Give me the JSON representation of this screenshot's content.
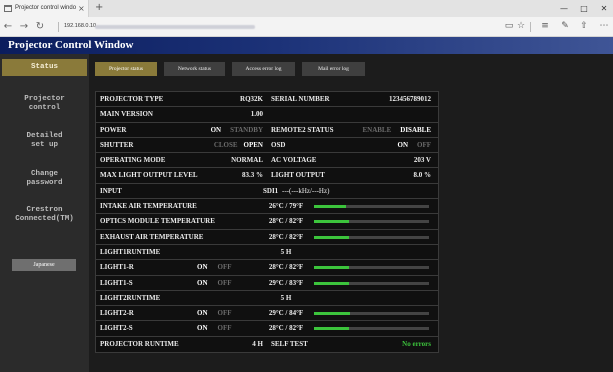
{
  "browser": {
    "tab_title": "Projector control windo",
    "tab_close": {
      "name": "close-icon",
      "glyph": "×"
    },
    "new_tab": {
      "name": "plus-icon",
      "glyph": "+"
    },
    "window_controls": {
      "minimize": {
        "name": "minimize-icon",
        "glyph": "—"
      },
      "maximize": {
        "name": "maximize-icon",
        "glyph": "□"
      },
      "close": {
        "name": "close-icon",
        "glyph": "✕"
      }
    },
    "nav": {
      "back": {
        "name": "back-arrow-icon",
        "glyph": "←"
      },
      "forward": {
        "name": "forward-arrow-icon",
        "glyph": "→"
      },
      "refresh": {
        "name": "refresh-icon",
        "glyph": "↻"
      }
    },
    "address": "192.168.0.10",
    "toolbar_icons": {
      "reading_view": {
        "name": "reading-view-icon",
        "glyph": "▭"
      },
      "favorite": {
        "name": "star-icon",
        "glyph": "☆"
      },
      "hub": {
        "name": "hub-icon",
        "glyph": "≡"
      },
      "web_note": {
        "name": "web-note-icon",
        "glyph": "✎"
      },
      "share": {
        "name": "share-icon",
        "glyph": "⇧"
      },
      "more": {
        "name": "more-icon",
        "glyph": "⋯"
      }
    }
  },
  "page": {
    "title": "Projector Control Window",
    "sidebar": {
      "active": "Status",
      "items": [
        {
          "lines": [
            "Status"
          ]
        },
        {
          "lines": [
            "Projector",
            "control"
          ]
        },
        {
          "lines": [
            "Detailed",
            "set up"
          ]
        },
        {
          "lines": [
            "Change",
            "password"
          ]
        },
        {
          "lines": [
            "Crestron",
            "Connected(TM)"
          ]
        }
      ],
      "language_button": "Japanese"
    },
    "tabs": {
      "active": "Projector status",
      "items": [
        {
          "label": "Projector status"
        },
        {
          "label": "Network status"
        },
        {
          "label": "Access error log"
        },
        {
          "label": "Mail error log"
        }
      ]
    }
  },
  "status": {
    "projector_type": {
      "label": "PROJECTOR TYPE",
      "value": "RQ32K"
    },
    "serial_number": {
      "label": "SERIAL NUMBER",
      "value": "123456789012"
    },
    "main_version": {
      "label": "MAIN VERSION",
      "value": "1.00"
    },
    "power": {
      "label": "POWER",
      "options": {
        "on": "ON",
        "standby": "STANDBY"
      },
      "state": "ON"
    },
    "remote2_status": {
      "label": "REMOTE2 STATUS",
      "options": {
        "enable": "ENABLE",
        "disable": "DISABLE"
      },
      "state": "DISABLE"
    },
    "shutter": {
      "label": "SHUTTER",
      "options": {
        "close": "CLOSE",
        "open": "OPEN"
      },
      "state": "OPEN"
    },
    "osd": {
      "label": "OSD",
      "options": {
        "on": "ON",
        "off": "OFF"
      },
      "state": "ON"
    },
    "operating_mode": {
      "label": "OPERATING MODE",
      "value": "NORMAL"
    },
    "ac_voltage": {
      "label": "AC VOLTAGE",
      "value": "203 V"
    },
    "max_light_output_level": {
      "label": "MAX LIGHT OUTPUT LEVEL",
      "value": "83.3 %"
    },
    "light_output": {
      "label": "LIGHT OUTPUT",
      "value": "8.0 %"
    },
    "input": {
      "label": "INPUT",
      "value": "SDI1",
      "signal": "---(---kHz/---Hz)"
    },
    "intake_air_temperature": {
      "label": "INTAKE AIR TEMPERATURE",
      "value": "26°C / 79°F",
      "level": 0.28
    },
    "optics_module_temperature": {
      "label": "OPTICS MODULE TEMPERATURE",
      "value": "28°C / 82°F",
      "level": 0.3
    },
    "exhaust_air_temperature": {
      "label": "EXHAUST AIR TEMPERATURE",
      "value": "28°C / 82°F",
      "level": 0.3
    },
    "light1_runtime": {
      "label": "LIGHT1RUNTIME",
      "value": "5 H"
    },
    "light1_r": {
      "label": "LIGHT1-R",
      "options": {
        "on": "ON",
        "off": "OFF"
      },
      "state": "ON",
      "temperature": "28°C / 82°F",
      "level": 0.3
    },
    "light1_s": {
      "label": "LIGHT1-S",
      "options": {
        "on": "ON",
        "off": "OFF"
      },
      "state": "ON",
      "temperature": "29°C / 83°F",
      "level": 0.3
    },
    "light2_runtime": {
      "label": "LIGHT2RUNTIME",
      "value": "5 H"
    },
    "light2_r": {
      "label": "LIGHT2-R",
      "options": {
        "on": "ON",
        "off": "OFF"
      },
      "state": "ON",
      "temperature": "29°C / 84°F",
      "level": 0.31
    },
    "light2_s": {
      "label": "LIGHT2-S",
      "options": {
        "on": "ON",
        "off": "OFF"
      },
      "state": "ON",
      "temperature": "28°C / 82°F",
      "level": 0.3
    },
    "projector_runtime": {
      "label": "PROJECTOR RUNTIME",
      "value": "4 H"
    },
    "self_test": {
      "label": "SELF TEST",
      "value": "No errors"
    }
  },
  "colors": {
    "accent_gold": "#8a7a3a",
    "tab_inactive": "#3f3f3f",
    "ok_green": "#3cc43c",
    "bar_fill": "#3cc43c",
    "title_bar_dark": "#0b1d5d",
    "title_bar_light": "#3f5596"
  }
}
